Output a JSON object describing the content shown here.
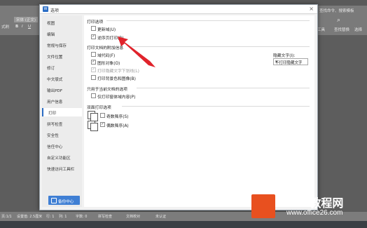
{
  "background_app": {
    "font_box": "宋体 (正文)",
    "bold": "B",
    "italic": "I",
    "underline": "U",
    "left_cut": "式刷",
    "right_labels": [
      "工具",
      "查找替换",
      "选择"
    ],
    "search": "查找命令、搜索模板"
  },
  "dialog": {
    "logo_text": "W",
    "title": "选项",
    "close": "×",
    "nav": [
      {
        "label": "视图",
        "active": false
      },
      {
        "label": "编辑",
        "active": false
      },
      {
        "label": "常规与保存",
        "active": false
      },
      {
        "label": "文件位置",
        "active": false
      },
      {
        "label": "修订",
        "active": false
      },
      {
        "label": "中文版式",
        "active": false
      },
      {
        "label": "输出PDF",
        "active": false
      },
      {
        "label": "用户信息",
        "active": false
      },
      {
        "label": "打印",
        "active": true
      },
      {
        "label": "拼写检查",
        "active": false
      },
      {
        "label": "安全性",
        "active": false
      },
      {
        "label": "信任中心",
        "active": false
      },
      {
        "label": "自定义功能区",
        "active": false
      },
      {
        "label": "快速访问工具栏",
        "active": false
      }
    ],
    "backup_button": "备份中心",
    "print_options": {
      "heading": "打印选项",
      "items": [
        {
          "label": "更新域(U)",
          "checked": false
        },
        {
          "label": "逆序页打印(R)",
          "checked": true
        }
      ]
    },
    "attached_info": {
      "heading": "打印文档的附加信息",
      "items": [
        {
          "label": "域代码(F)",
          "checked": false,
          "disabled": false
        },
        {
          "label": "图形对象(O)",
          "checked": true,
          "disabled": false
        },
        {
          "label": "打印隐藏文字下划线(L)",
          "checked": true,
          "disabled": true
        },
        {
          "label": "打印背景色和图像(B)",
          "checked": false,
          "disabled": false
        }
      ],
      "hidden_text_label": "隐藏文字(I):",
      "hidden_text_value": "不打印隐藏文字"
    },
    "current_doc": {
      "heading": "只用于当前文档的选项",
      "items": [
        {
          "label": "仅打印窗体域内容(P)",
          "checked": false
        }
      ]
    },
    "duplex": {
      "heading": "双面打印选项",
      "items": [
        {
          "label": "奇数降序(S)",
          "checked": false
        },
        {
          "label": "偶数降序(A)",
          "checked": true
        }
      ]
    }
  },
  "status_bar": {
    "page": "页:1/1",
    "settings": "设置值: 2.5厘米",
    "row": "行: 1",
    "col": "列: 1",
    "words": "字数: 0",
    "spell": "拼写检查",
    "compare": "文档校对",
    "unsaved": "未认证"
  },
  "watermark": {
    "brand": "Office教程网",
    "url": "www.office26.com"
  },
  "colors": {
    "accent": "#2a6bc2",
    "backup_button": "#3f7fd4",
    "arrow": "#e0232b",
    "brand_logo": "#e8501f"
  }
}
